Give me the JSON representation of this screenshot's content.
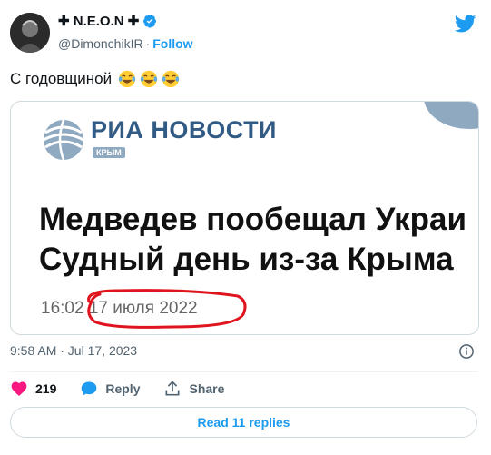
{
  "author": {
    "display_name": "✚ N.E.O.N ✚",
    "handle": "@DimonchikIR",
    "separator": "·",
    "follow_label": "Follow"
  },
  "tweet": {
    "text": "С годовщиной",
    "emojis": [
      "face-with-tears-of-joy-icon",
      "face-with-tears-of-joy-icon",
      "face-with-tears-of-joy-icon"
    ],
    "timestamp": "9:58 AM · Jul 17, 2023"
  },
  "card": {
    "brand": "РИА НОВОСТИ",
    "brand_sub": "КРЫМ",
    "headline_line1": "Медведев пообещал Украи",
    "headline_line2": "Судный день из-за Крыма",
    "time": "16:02",
    "date": "17 июля 2022"
  },
  "actions": {
    "likes": "219",
    "reply_label": "Reply",
    "share_label": "Share"
  },
  "read_replies_label": "Read 11 replies",
  "colors": {
    "accent": "#1d9bf0",
    "brand": "#315b84",
    "heart": "#f91880",
    "scribble": "#e0141e"
  }
}
